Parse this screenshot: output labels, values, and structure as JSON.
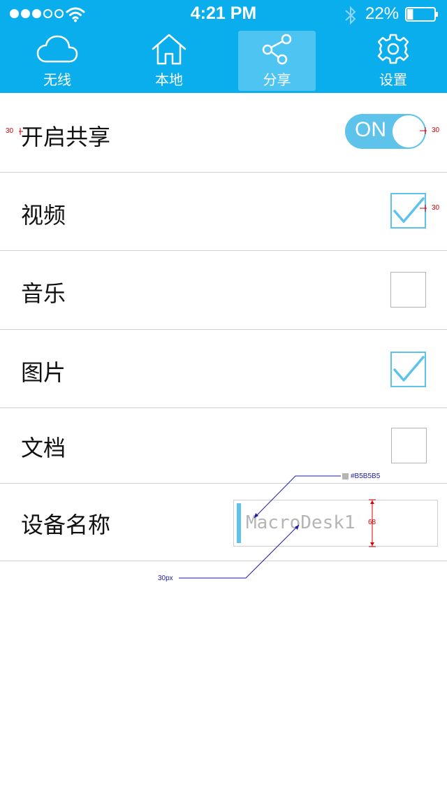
{
  "status_bar": {
    "time": "4:21 PM",
    "battery_percent": "22%",
    "battery_level": 0.22,
    "signal_bars_filled": 3,
    "signal_bars_total": 5
  },
  "tabs": [
    {
      "label": "无线",
      "icon": "cloud-icon",
      "active": false
    },
    {
      "label": "本地",
      "icon": "home-icon",
      "active": false
    },
    {
      "label": "分享",
      "icon": "share-icon",
      "active": true
    },
    {
      "label": "设置",
      "icon": "gear-icon",
      "active": false
    }
  ],
  "settings": {
    "share_enable": {
      "label": "开启共享",
      "toggle_text": "ON",
      "on": true
    },
    "video": {
      "label": "视频",
      "checked": true
    },
    "music": {
      "label": "音乐",
      "checked": false
    },
    "pictures": {
      "label": "图片",
      "checked": true
    },
    "documents": {
      "label": "文档",
      "checked": false
    },
    "device_name": {
      "label": "设备名称",
      "value": "MacroDesk1"
    }
  },
  "annotations": {
    "left_margin": "30",
    "right_margin_toggle": "30",
    "right_margin_checkbox": "30",
    "text_color": "#B5B5B5",
    "input_height": "68",
    "input_padding": "30px"
  },
  "colors": {
    "header_bg": "#0aaeed",
    "accent": "#5dc3ea",
    "placeholder_gray": "#b5b5b5",
    "divider": "#cfcfcf"
  }
}
